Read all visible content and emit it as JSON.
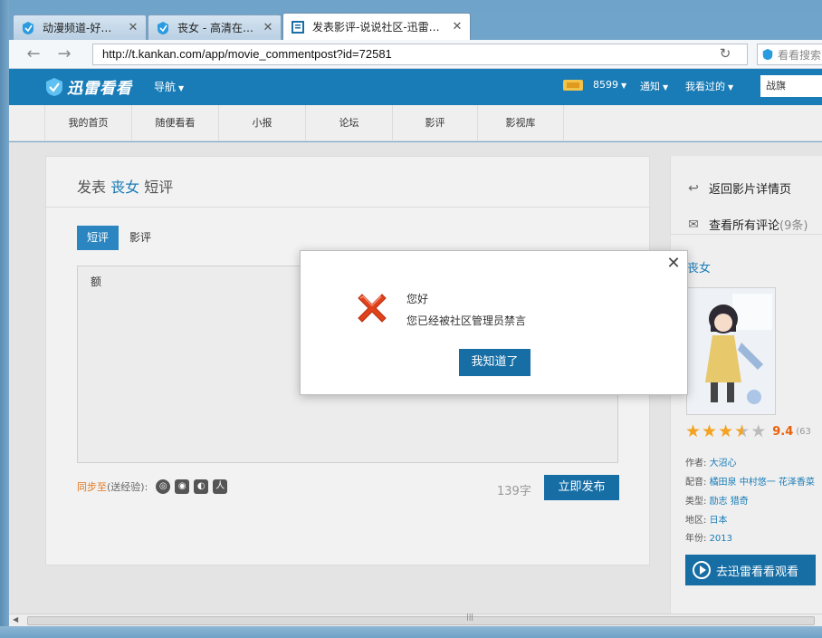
{
  "browser": {
    "tabs": [
      {
        "label": "动漫频道-好…",
        "icon": "kankan-tab-icon"
      },
      {
        "label": "丧女 - 高清在…",
        "icon": "kankan-tab-icon"
      },
      {
        "label": "发表影评-说说社区-迅雷…",
        "icon": "shuoshuo-tab-icon"
      }
    ],
    "close_glyph": "✕",
    "url": "http://t.kankan.com/app/movie_commentpost?id=72581",
    "search_placeholder": "看看搜索"
  },
  "site": {
    "logo_text": "迅雷看看",
    "nav_label": "导航",
    "points": "8599",
    "notice_label": "通知",
    "watched_label": "我看过的",
    "search_value": "战旗",
    "subnav": [
      "我的首页",
      "随便看看",
      "小报",
      "论坛",
      "影评",
      "影视库"
    ]
  },
  "main": {
    "title_prefix": "发表",
    "movie_name": "丧女",
    "title_suffix": "短评",
    "tab_short": "短评",
    "tab_long": "影评",
    "textarea_value": "额",
    "sync_label": "同步至",
    "sync_hint": "(送经验):",
    "char_count": "139字",
    "publish_label": "立即发布"
  },
  "sidebar": {
    "back_label": "返回影片详情页",
    "all_comments_label": "查看所有评论",
    "all_comments_count": "(9条)",
    "movie_title": "丧女",
    "rating": "9.4",
    "rating_count": "(63",
    "rating_stars": 3.5,
    "author_key": "作者:",
    "author_val": "大沼心",
    "cast_key": "配音:",
    "cast_val": "橘田泉 中村悠一 花泽香菜",
    "genre_key": "类型:",
    "genre_val": "励志 猎奇",
    "region_key": "地区:",
    "region_val": "日本",
    "year_key": "年份:",
    "year_val": "2013",
    "watch_label": "去迅雷看看观看"
  },
  "dialog": {
    "title": "您好",
    "message": "您已经被社区管理员禁言",
    "ok_label": "我知道了",
    "close_glyph": "✕"
  },
  "colors": {
    "brand_blue": "#197cb7",
    "button_blue": "#166ea5",
    "accent_orange": "#e2771d",
    "error_red": "#e0421b"
  }
}
